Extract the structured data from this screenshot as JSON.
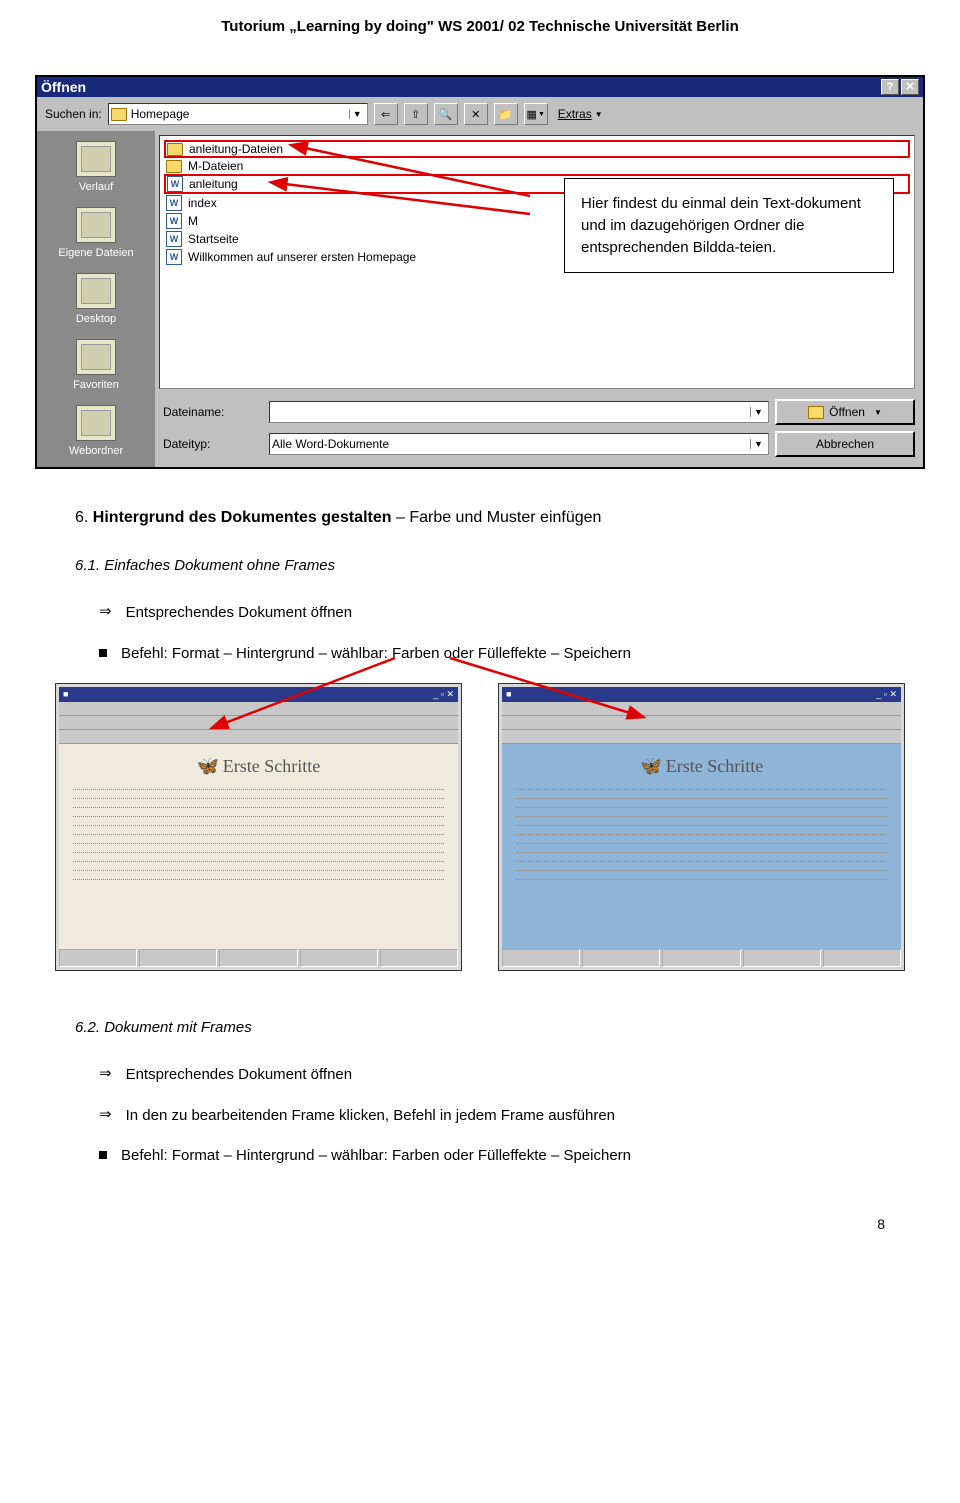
{
  "header": "Tutorium „Learning by doing\" WS 2001/ 02 Technische Universität Berlin",
  "dialog": {
    "title": "Öffnen",
    "lookin_label": "Suchen in:",
    "lookin_value": "Homepage",
    "extras": "Extras",
    "places": [
      "Verlauf",
      "Eigene Dateien",
      "Desktop",
      "Favoriten",
      "Webordner"
    ],
    "files": [
      {
        "icon": "folder",
        "name": "anleitung-Dateien",
        "hl": true
      },
      {
        "icon": "folder",
        "name": "M-Dateien"
      },
      {
        "icon": "word",
        "name": "anleitung",
        "hl": true
      },
      {
        "icon": "word",
        "name": "index"
      },
      {
        "icon": "word",
        "name": "M"
      },
      {
        "icon": "word",
        "name": "Startseite"
      },
      {
        "icon": "word",
        "name": "Willkommen auf unserer ersten Homepage"
      }
    ],
    "filename_label": "Dateiname:",
    "filename_value": "",
    "filetype_label": "Dateityp:",
    "filetype_value": "Alle Word-Dokumente",
    "open_btn": "Öffnen",
    "cancel_btn": "Abbrechen"
  },
  "callout": "Hier findest du einmal dein Text-dokument und im dazugehörigen Ordner die entsprechenden Bildda-teien.",
  "section6": {
    "num": "6.",
    "title": "Hintergrund des Dokumentes gestalten",
    "suffix": "Farbe und Muster einfügen"
  },
  "section61": {
    "num": "6.1.",
    "title": "Einfaches Dokument ohne Frames",
    "items": [
      {
        "mark": "arrow",
        "text": "Entsprechendes Dokument öffnen"
      },
      {
        "mark": "square",
        "text": "Befehl: Format – Hintergrund – wählbar: Farben oder Fülleffekte – Speichern"
      }
    ]
  },
  "shots": {
    "heading": "Erste Schritte"
  },
  "section62": {
    "num": "6.2.",
    "title": "Dokument mit Frames",
    "items": [
      {
        "mark": "arrow",
        "text": "Entsprechendes Dokument öffnen"
      },
      {
        "mark": "arrow",
        "text": "In den zu bearbeitenden Frame klicken, Befehl in jedem Frame ausführen"
      },
      {
        "mark": "square",
        "text": "Befehl: Format – Hintergrund – wählbar: Farben oder Fülleffekte – Speichern"
      }
    ]
  },
  "page_number": "8"
}
